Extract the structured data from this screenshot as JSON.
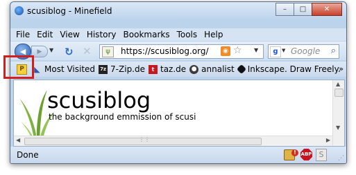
{
  "window": {
    "title": "scusiblog - Minefield",
    "minimize": "–",
    "maximize": "□",
    "close": "✕"
  },
  "menu": [
    "File",
    "Edit",
    "View",
    "History",
    "Bookmarks",
    "Tools",
    "Help"
  ],
  "nav": {
    "url": "https://scusiblog.org/",
    "search_placeholder": "Google"
  },
  "bookmarks": [
    {
      "label": "",
      "icon": "page-p-icon"
    },
    {
      "label": "Most Visited",
      "icon": "most-visited-icon"
    },
    {
      "label": "7-Zip.de",
      "icon": "7zip-icon"
    },
    {
      "label": "taz.de",
      "icon": "taz-icon"
    },
    {
      "label": "annalist",
      "icon": "annalist-icon"
    },
    {
      "label": "Inkscape. Draw Freely.",
      "icon": "inkscape-icon"
    }
  ],
  "page": {
    "title": "scusiblog",
    "subtitle": "the background emmission of scusi"
  },
  "status": {
    "text": "Done"
  },
  "colors": {
    "highlight": "#d41e1e",
    "chrome": "#bcd3ec"
  }
}
